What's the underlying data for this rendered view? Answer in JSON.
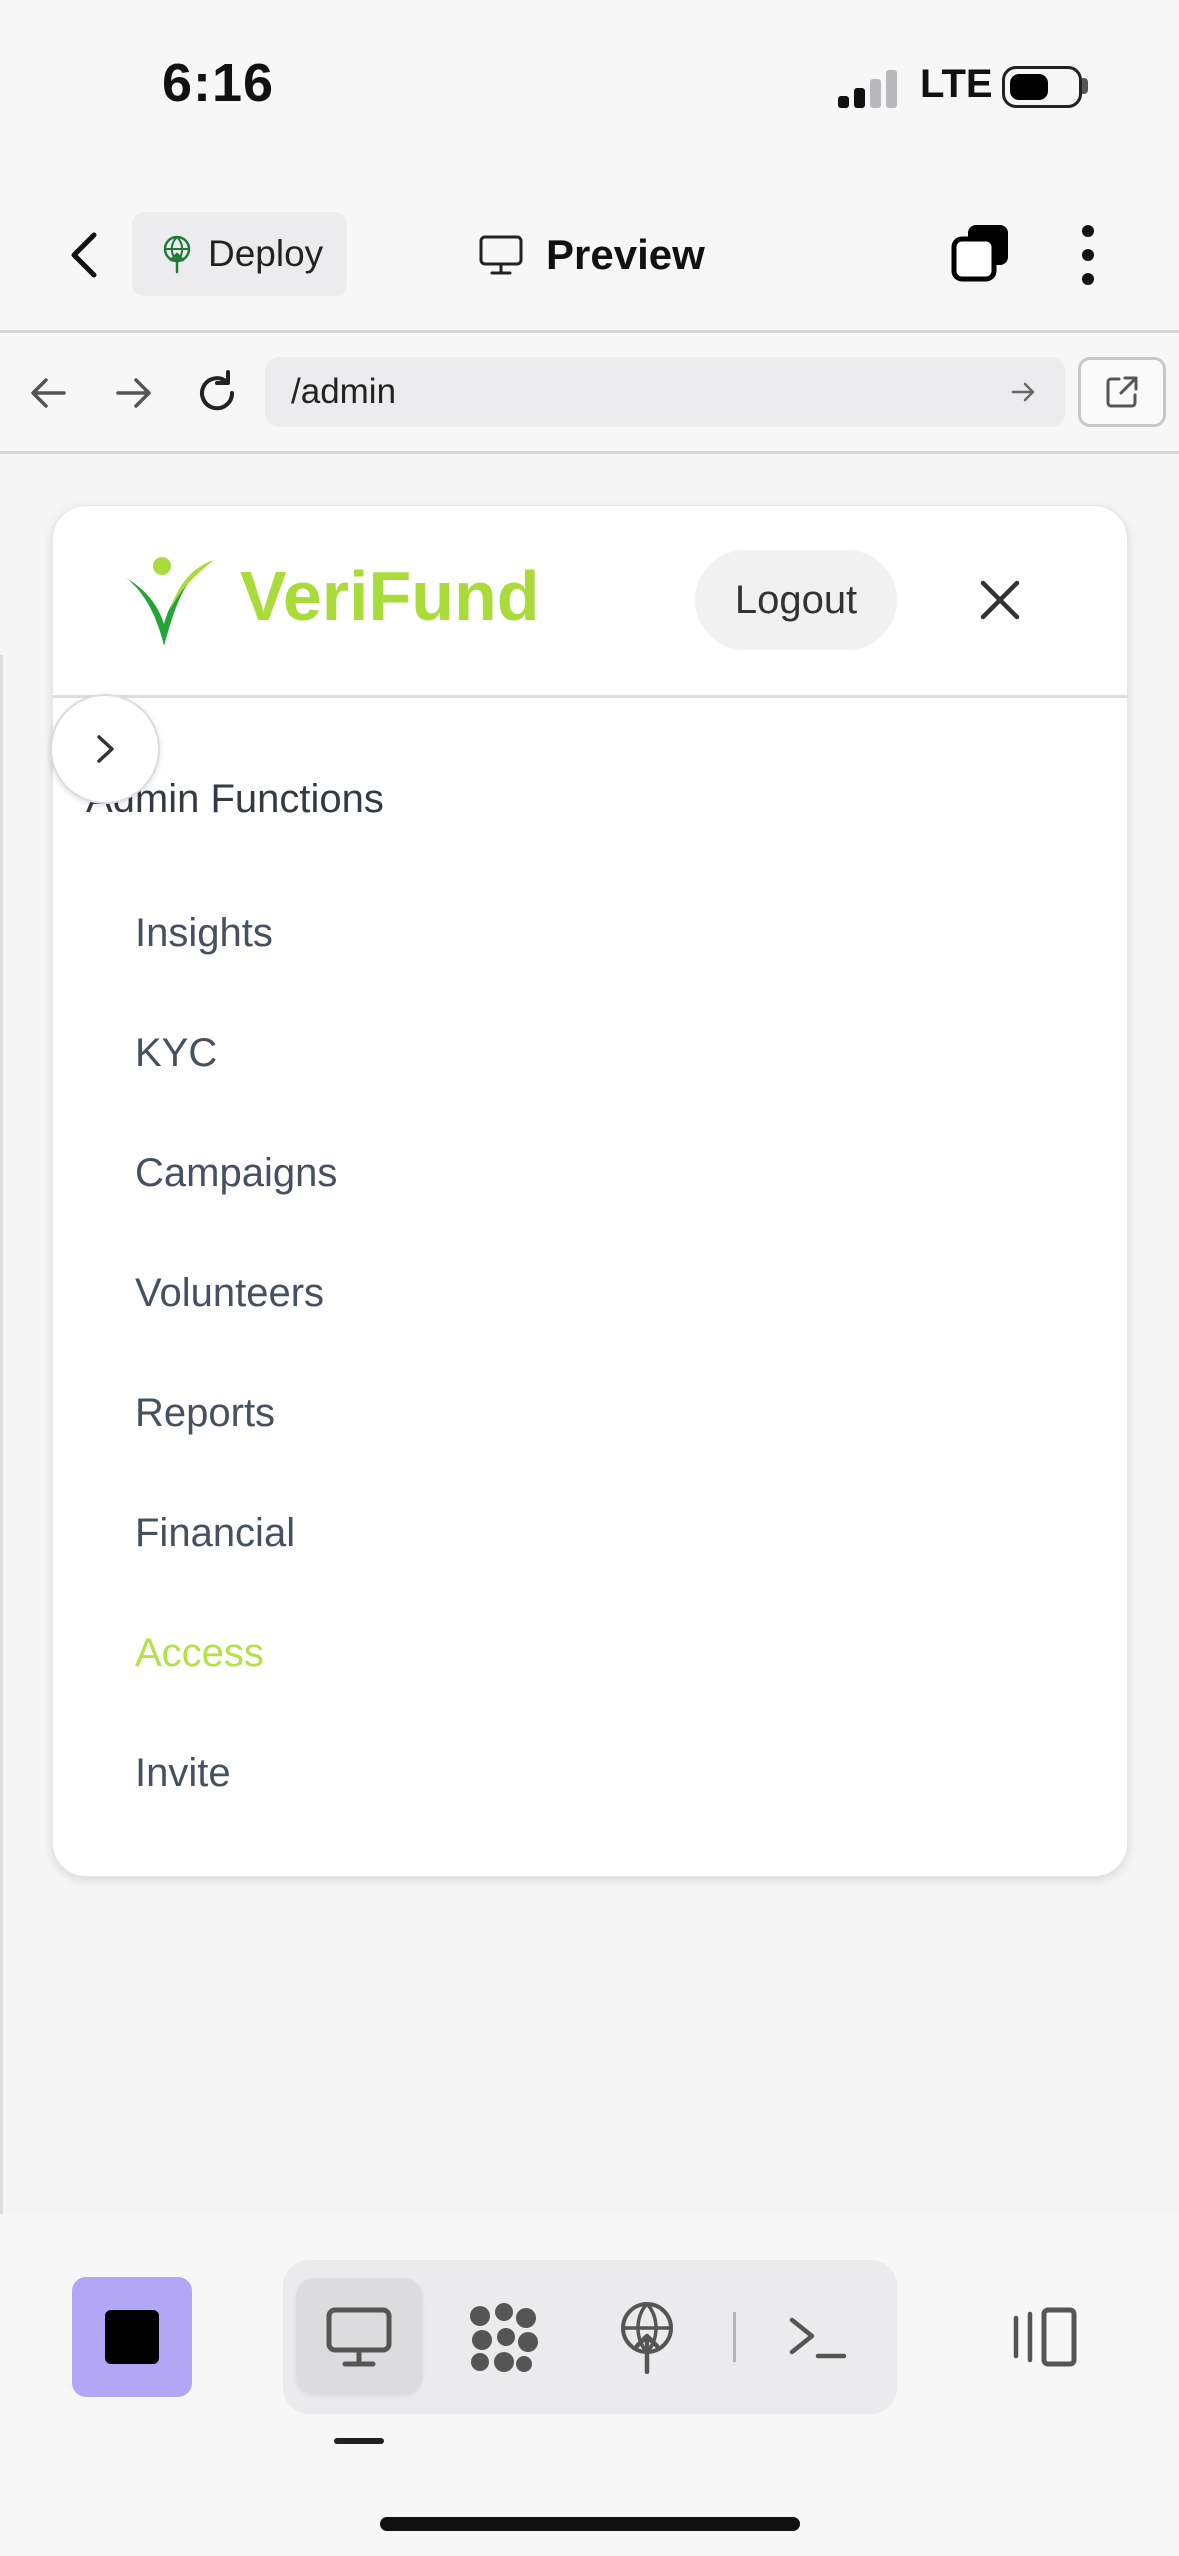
{
  "status_bar": {
    "time": "6:16",
    "network": "LTE"
  },
  "header": {
    "deploy_label": "Deploy",
    "preview_label": "Preview"
  },
  "url_bar": {
    "path": "/admin"
  },
  "card": {
    "brand": "VeriFund",
    "logout_label": "Logout",
    "section_title": "Admin Functions",
    "menu_items": [
      {
        "label": "Insights",
        "active": false
      },
      {
        "label": "KYC",
        "active": false
      },
      {
        "label": "Campaigns",
        "active": false
      },
      {
        "label": "Volunteers",
        "active": false
      },
      {
        "label": "Reports",
        "active": false
      },
      {
        "label": "Financial",
        "active": false
      },
      {
        "label": "Access",
        "active": true
      },
      {
        "label": "Invite",
        "active": false
      }
    ]
  },
  "colors": {
    "brand_green": "#a9dc3a",
    "active_item": "#b4e04a",
    "stop_button": "#b3a6f7",
    "menu_text": "#465060"
  },
  "icons": {
    "header": [
      "chevron-left-icon",
      "globe-upload-icon",
      "monitor-icon",
      "stacked-squares-icon",
      "kebab-menu-icon"
    ],
    "url_bar": [
      "arrow-left-icon",
      "arrow-right-icon",
      "reload-icon",
      "arrow-right-small-icon",
      "external-link-icon"
    ],
    "card": [
      "verifund-logo",
      "close-icon",
      "chevron-right-icon"
    ],
    "toolbar": [
      "stop-icon",
      "monitor-icon",
      "dots-cluster-icon",
      "globe-upload-icon",
      "terminal-icon",
      "split-panel-icon"
    ]
  }
}
